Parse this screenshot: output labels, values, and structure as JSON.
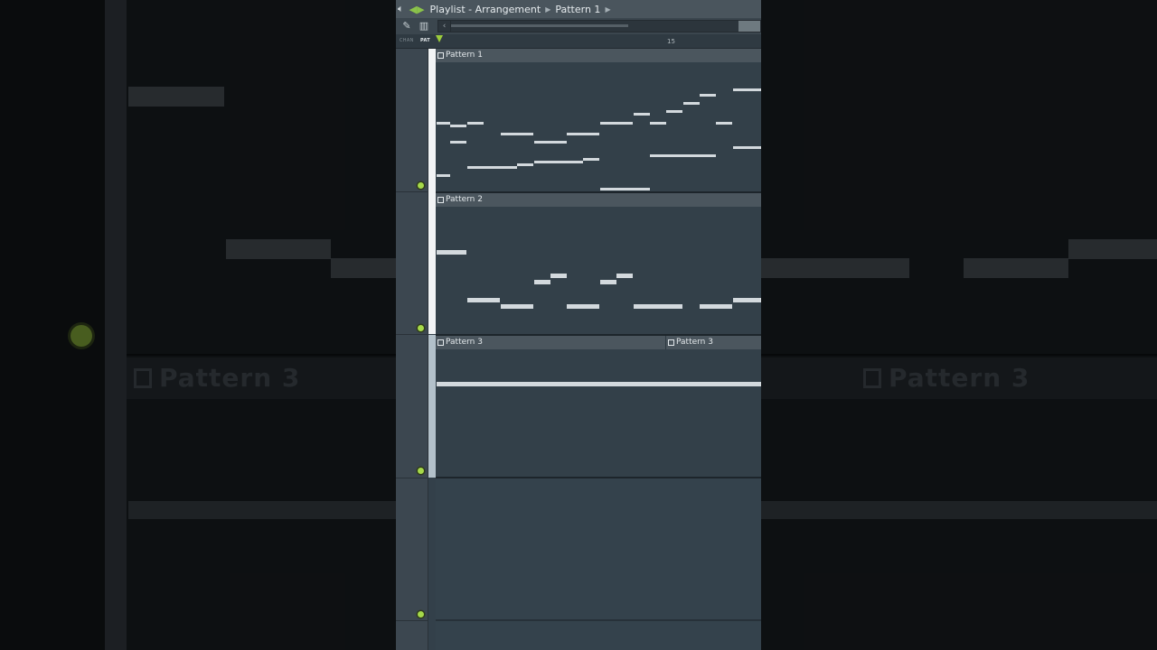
{
  "window": {
    "breadcrumb": [
      "Playlist - Arrangement",
      "Pattern 1"
    ],
    "view_modes": [
      "CHAN",
      "PAT"
    ],
    "active_view_mode": "PAT",
    "ruler_bar_label": "15"
  },
  "tracks": [
    {
      "clips": [
        {
          "label": "Pattern 1"
        }
      ]
    },
    {
      "clips": [
        {
          "label": "Pattern 2"
        }
      ]
    },
    {
      "clips": [
        {
          "label": "Pattern 3"
        },
        {
          "label": "Pattern 3"
        }
      ]
    },
    {
      "clips": []
    }
  ],
  "background": {
    "zoom_label": "Pattern 3"
  },
  "colors": {
    "accent_green": "#a6d94a",
    "clip_header": "#4b565e",
    "note": "#d3d9dd"
  },
  "icons": [
    "search-icon",
    "speaker-icon",
    "play-arrow-icon",
    "pencil-icon",
    "piano-roll-icon",
    "scroll-left-icon",
    "pattern-clip-icon"
  ]
}
